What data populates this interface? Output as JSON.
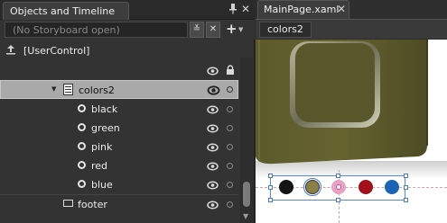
{
  "left_panel": {
    "tab_title": "Objects and Timeline",
    "storyboard_placeholder": "(No Storyboard open)",
    "tree": {
      "root_label": "[UserControl]",
      "selected_label": "colors2",
      "children": [
        {
          "label": "black"
        },
        {
          "label": "green"
        },
        {
          "label": "pink"
        },
        {
          "label": "red"
        },
        {
          "label": "blue"
        }
      ],
      "footer_label": "footer"
    }
  },
  "right_panel": {
    "tab_title": "MainPage.xaml",
    "breadcrumb": "colors2",
    "swatches": [
      {
        "name": "black",
        "color": "#141414"
      },
      {
        "name": "green",
        "color": "#8a7f44"
      },
      {
        "name": "pink",
        "color": "#e7a1c4"
      },
      {
        "name": "red",
        "color": "#a30f1b"
      },
      {
        "name": "blue",
        "color": "#1d63b3"
      }
    ]
  }
}
